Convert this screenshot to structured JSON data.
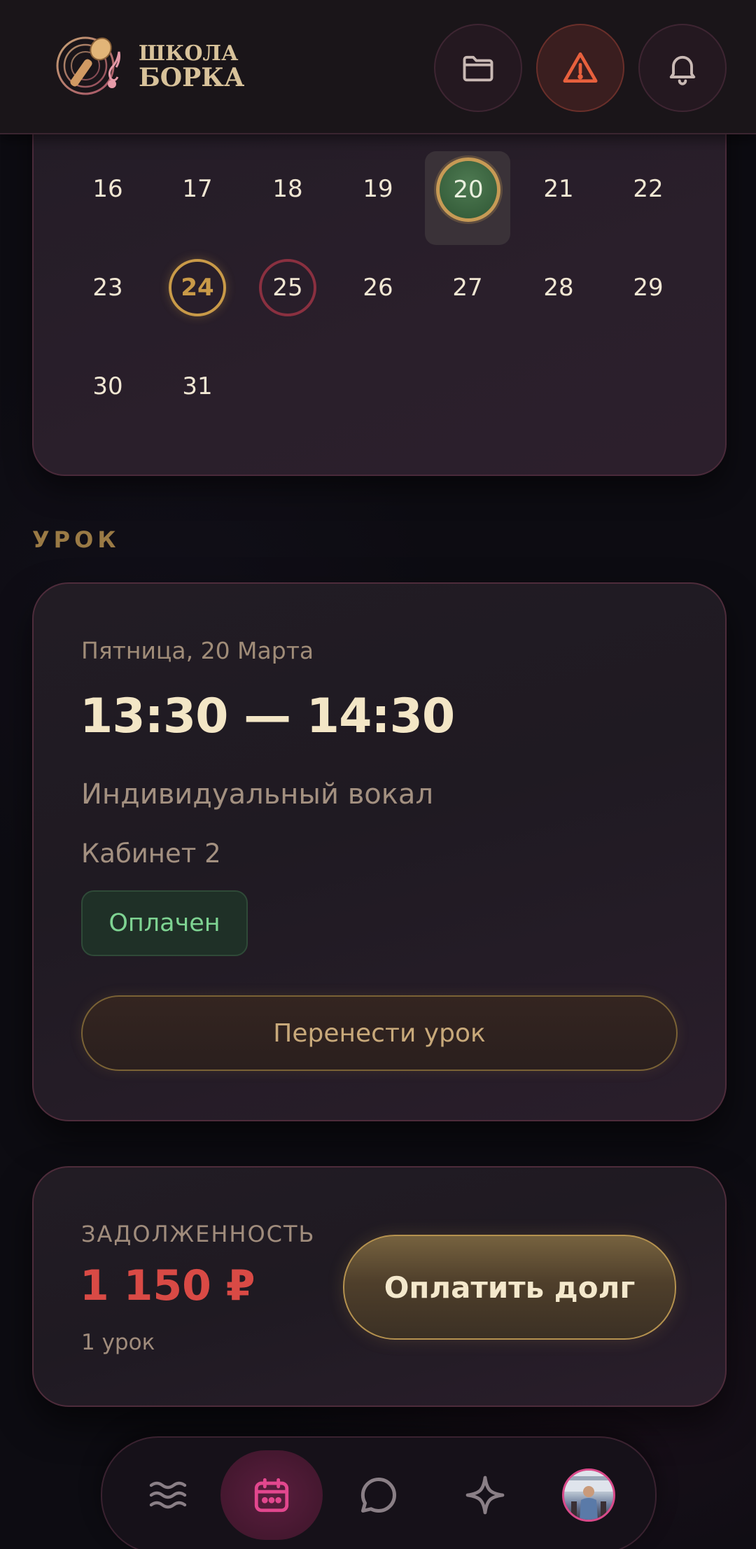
{
  "header": {
    "logo": {
      "line1": "ШКОЛА",
      "line2": "БОРКА"
    },
    "icons": [
      "folder-icon",
      "alert-icon",
      "bell-icon"
    ]
  },
  "calendar": {
    "rows": [
      [
        "16",
        "17",
        "18",
        "19",
        "20",
        "21",
        "22"
      ],
      [
        "23",
        "24",
        "25",
        "26",
        "27",
        "28",
        "29"
      ],
      [
        "30",
        "31"
      ]
    ],
    "selected_day": "20",
    "highlighted_gold": "24",
    "highlighted_red": "25"
  },
  "lesson": {
    "section_title": "УРОК",
    "date": "Пятница, 20 Марта",
    "time": "13:30 — 14:30",
    "type": "Индивидуальный вокал",
    "room": "Кабинет 2",
    "status": "Оплачен",
    "move_button": "Перенести урок"
  },
  "debt": {
    "label": "ЗАДОЛЖЕННОСТЬ",
    "amount": "1 150 ₽",
    "count": "1 урок",
    "pay_button": "Оплатить долг"
  },
  "nav": {
    "items": [
      "menu-icon",
      "calendar-icon",
      "chat-icon",
      "sparkle-icon",
      "avatar"
    ],
    "active": "calendar-icon"
  },
  "colors": {
    "accent_gold": "#c99a48",
    "accent_pink": "#d94a8a",
    "debt_red": "#d94a45",
    "paid_green": "#7ed392"
  }
}
